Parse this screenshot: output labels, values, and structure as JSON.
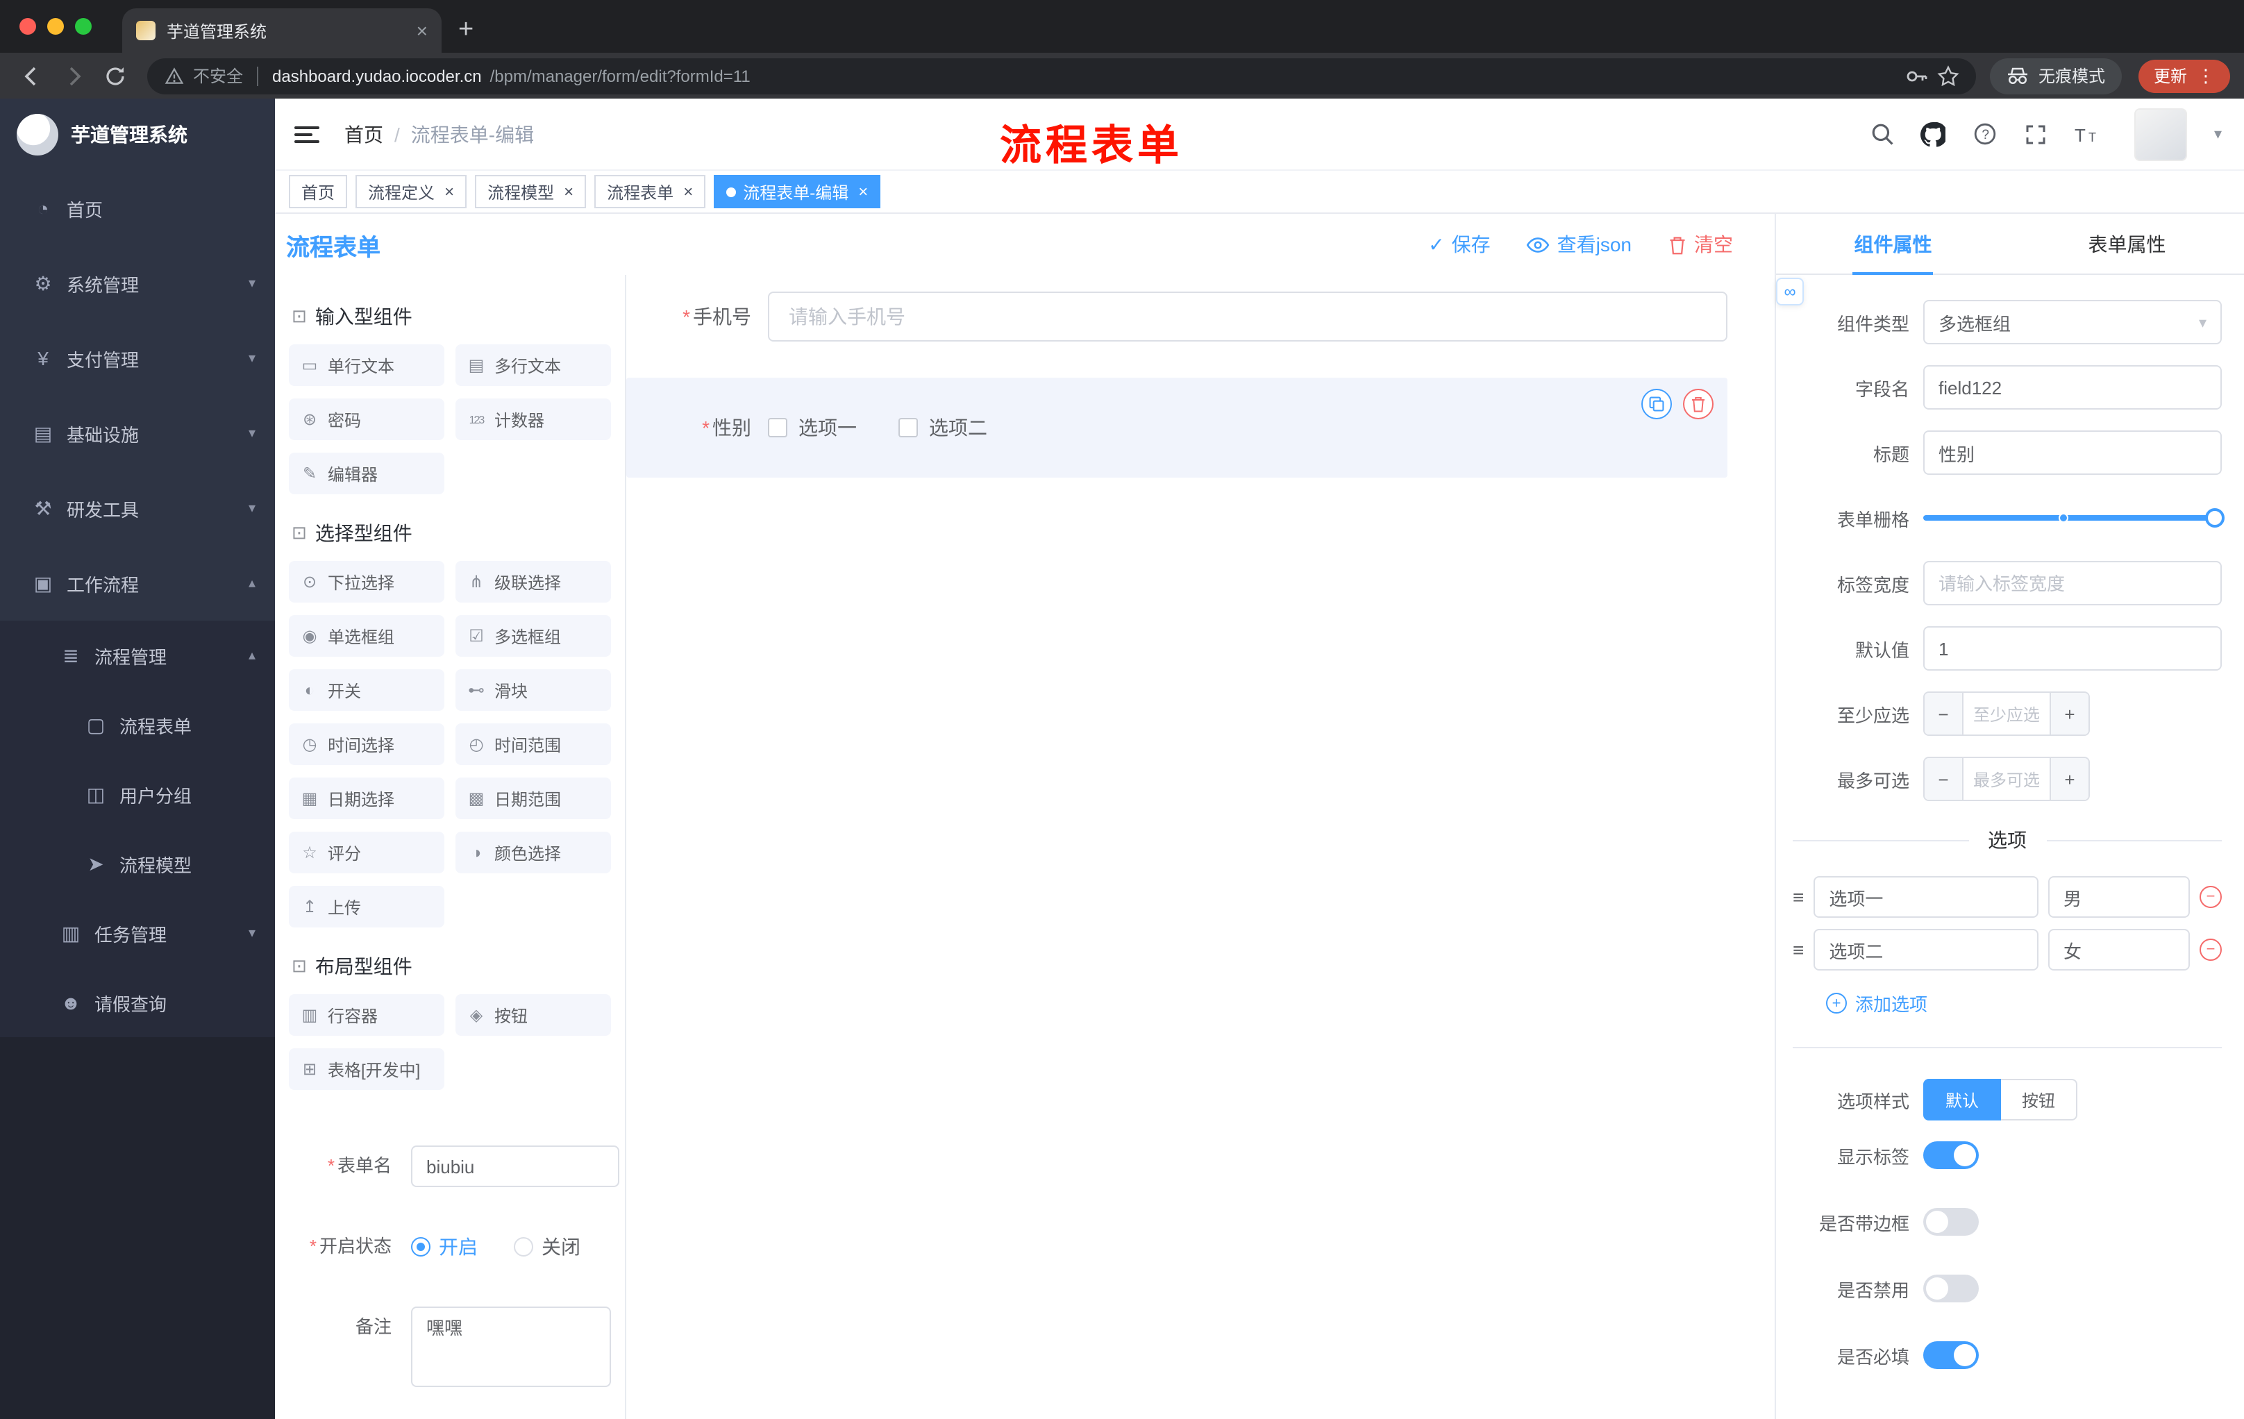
{
  "browser": {
    "tab_title": "芋道管理系统",
    "security_text": "不安全",
    "url_domain": "dashboard.yudao.iocoder.cn",
    "url_path": "/bpm/manager/form/edit?formId=11",
    "incognito_label": "无痕模式",
    "update_label": "更新",
    "menu_glyph": "⋮",
    "new_tab_glyph": "+"
  },
  "annotation_text": "流程表单",
  "header": {
    "logo_title": "芋道管理系统",
    "breadcrumb_home": "首页",
    "breadcrumb_sep": "/",
    "breadcrumb_current": "流程表单-编辑"
  },
  "tags": [
    {
      "id": "home",
      "label": "首页",
      "closable": false,
      "active": false
    },
    {
      "id": "process-definition",
      "label": "流程定义",
      "closable": true,
      "active": false
    },
    {
      "id": "process-model",
      "label": "流程模型",
      "closable": true,
      "active": false
    },
    {
      "id": "process-form",
      "label": "流程表单",
      "closable": true,
      "active": false
    },
    {
      "id": "process-form-edit",
      "label": "流程表单-编辑",
      "closable": true,
      "active": true
    }
  ],
  "sidebar": [
    {
      "id": "home",
      "label": "首页",
      "icon": "dashboard-icon",
      "level": 1,
      "sub": false
    },
    {
      "id": "system",
      "label": "系统管理",
      "icon": "gear-icon",
      "level": 1,
      "sub": false,
      "arrow": "down"
    },
    {
      "id": "payment",
      "label": "支付管理",
      "icon": "yen-icon",
      "level": 1,
      "sub": false,
      "arrow": "down"
    },
    {
      "id": "infra",
      "label": "基础设施",
      "icon": "infra-icon",
      "level": 1,
      "sub": false,
      "arrow": "down"
    },
    {
      "id": "devtools",
      "label": "研发工具",
      "icon": "tools-icon",
      "level": 1,
      "sub": false,
      "arrow": "down"
    },
    {
      "id": "workflow",
      "label": "工作流程",
      "icon": "workflow-icon",
      "level": 1,
      "sub": false,
      "arrow": "up"
    },
    {
      "id": "process-mgmt",
      "label": "流程管理",
      "icon": "list-icon",
      "level": 2,
      "sub": true,
      "arrow": "up"
    },
    {
      "id": "process-form",
      "label": "流程表单",
      "icon": "doc-icon",
      "level": 3,
      "sub": true
    },
    {
      "id": "user-group",
      "label": "用户分组",
      "icon": "users-icon",
      "level": 3,
      "sub": true
    },
    {
      "id": "process-model",
      "label": "流程模型",
      "icon": "send-icon",
      "level": 3,
      "sub": true
    },
    {
      "id": "task-mgmt",
      "label": "任务管理",
      "icon": "task-icon",
      "level": 2,
      "sub": true,
      "arrow": "down"
    },
    {
      "id": "leave-query",
      "label": "请假查询",
      "icon": "user-icon",
      "level": 2,
      "sub": true
    }
  ],
  "page": {
    "title": "流程表单",
    "save_label": "保存",
    "view_json_label": "查看json",
    "clear_label": "清空"
  },
  "library": {
    "sections": [
      {
        "title": "输入型组件",
        "items": [
          {
            "id": "input",
            "label": "单行文本",
            "icon": "input-icon"
          },
          {
            "id": "textarea",
            "label": "多行文本",
            "icon": "textarea-icon"
          },
          {
            "id": "password",
            "label": "密码",
            "icon": "password-icon"
          },
          {
            "id": "counter",
            "label": "计数器",
            "icon": "counter-icon"
          },
          {
            "id": "editor",
            "label": "编辑器",
            "icon": "editor-icon"
          }
        ]
      },
      {
        "title": "选择型组件",
        "items": [
          {
            "id": "select",
            "label": "下拉选择",
            "icon": "select-icon"
          },
          {
            "id": "cascader",
            "label": "级联选择",
            "icon": "cascader-icon"
          },
          {
            "id": "radio-group",
            "label": "单选框组",
            "icon": "radio-icon"
          },
          {
            "id": "checkbox-group",
            "label": "多选框组",
            "icon": "checkbox-icon"
          },
          {
            "id": "switch",
            "label": "开关",
            "icon": "switch-icon"
          },
          {
            "id": "slider",
            "label": "滑块",
            "icon": "slider-icon"
          },
          {
            "id": "time",
            "label": "时间选择",
            "icon": "time-icon"
          },
          {
            "id": "time-range",
            "label": "时间范围",
            "icon": "time-range-icon"
          },
          {
            "id": "date",
            "label": "日期选择",
            "icon": "date-icon"
          },
          {
            "id": "date-range",
            "label": "日期范围",
            "icon": "date-range-icon"
          },
          {
            "id": "rate",
            "label": "评分",
            "icon": "rate-icon"
          },
          {
            "id": "color",
            "label": "颜色选择",
            "icon": "color-icon"
          },
          {
            "id": "upload",
            "label": "上传",
            "icon": "upload-icon"
          }
        ]
      },
      {
        "title": "布局型组件",
        "items": [
          {
            "id": "row",
            "label": "行容器",
            "icon": "row-icon"
          },
          {
            "id": "button",
            "label": "按钮",
            "icon": "button-icon"
          },
          {
            "id": "table",
            "label": "表格[开发中]",
            "icon": "table-icon"
          }
        ]
      }
    ]
  },
  "form_meta": {
    "name_label": "表单名",
    "name_value": "biubiu",
    "status_label": "开启状态",
    "status_on": "开启",
    "status_off": "关闭",
    "remark_label": "备注",
    "remark_value": "嘿嘿"
  },
  "canvas": {
    "phone_label": "手机号",
    "phone_placeholder": "请输入手机号",
    "gender_label": "性别",
    "gender_options": [
      "选项一",
      "选项二"
    ]
  },
  "props": {
    "tab_component": "组件属性",
    "tab_form": "表单属性",
    "type_label": "组件类型",
    "type_value": "多选框组",
    "field_label": "字段名",
    "field_value": "field122",
    "title_label": "标题",
    "title_value": "性别",
    "grid_label": "表单栅格",
    "label_width_label": "标签宽度",
    "label_width_placeholder": "请输入标签宽度",
    "default_label": "默认值",
    "default_value": "1",
    "min_label": "至少应选",
    "min_placeholder": "至少应选",
    "max_label": "最多可选",
    "max_placeholder": "最多可选",
    "options_title": "选项",
    "options": [
      {
        "text": "选项一",
        "value": "男"
      },
      {
        "text": "选项二",
        "value": "女"
      }
    ],
    "add_option_label": "添加选项",
    "style_label": "选项样式",
    "style_options": [
      "默认",
      "按钮"
    ],
    "switches": [
      {
        "id": "show-label",
        "label": "显示标签",
        "on": true
      },
      {
        "id": "border",
        "label": "是否带边框",
        "on": false
      },
      {
        "id": "disabled",
        "label": "是否禁用",
        "on": false
      },
      {
        "id": "required",
        "label": "是否必填",
        "on": true
      }
    ]
  },
  "colors": {
    "accent": "#409eff",
    "danger": "#f56c6c",
    "annotation": "#fe1400"
  },
  "icons": {
    "dashboard-icon": "◔",
    "gear-icon": "⚙",
    "yen-icon": "¥",
    "infra-icon": "▤",
    "tools-icon": "⚒",
    "workflow-icon": "▣",
    "list-icon": "≣",
    "doc-icon": "▢",
    "users-icon": "◫",
    "send-icon": "➤",
    "task-icon": "▥",
    "user-icon": "☻",
    "input-icon": "▭",
    "textarea-icon": "▤",
    "password-icon": "⊛",
    "counter-icon": "123",
    "editor-icon": "✎",
    "select-icon": "⊙",
    "cascader-icon": "⋔",
    "radio-icon": "◉",
    "checkbox-icon": "☑",
    "switch-icon": "◐",
    "slider-icon": "⊷",
    "time-icon": "◷",
    "time-range-icon": "◴",
    "date-icon": "▦",
    "date-range-icon": "▩",
    "rate-icon": "☆",
    "color-icon": "◑",
    "upload-icon": "↥",
    "row-icon": "▥",
    "button-icon": "◈",
    "table-icon": "⊞",
    "section-icon": "⊡",
    "drag-icon": "≡",
    "caret-down-icon": "▾",
    "caret-up-icon": "▴",
    "link-icon": "∞",
    "check-icon": "✓",
    "plus-icon": "+",
    "minus-icon": "−",
    "close-icon": "×"
  }
}
